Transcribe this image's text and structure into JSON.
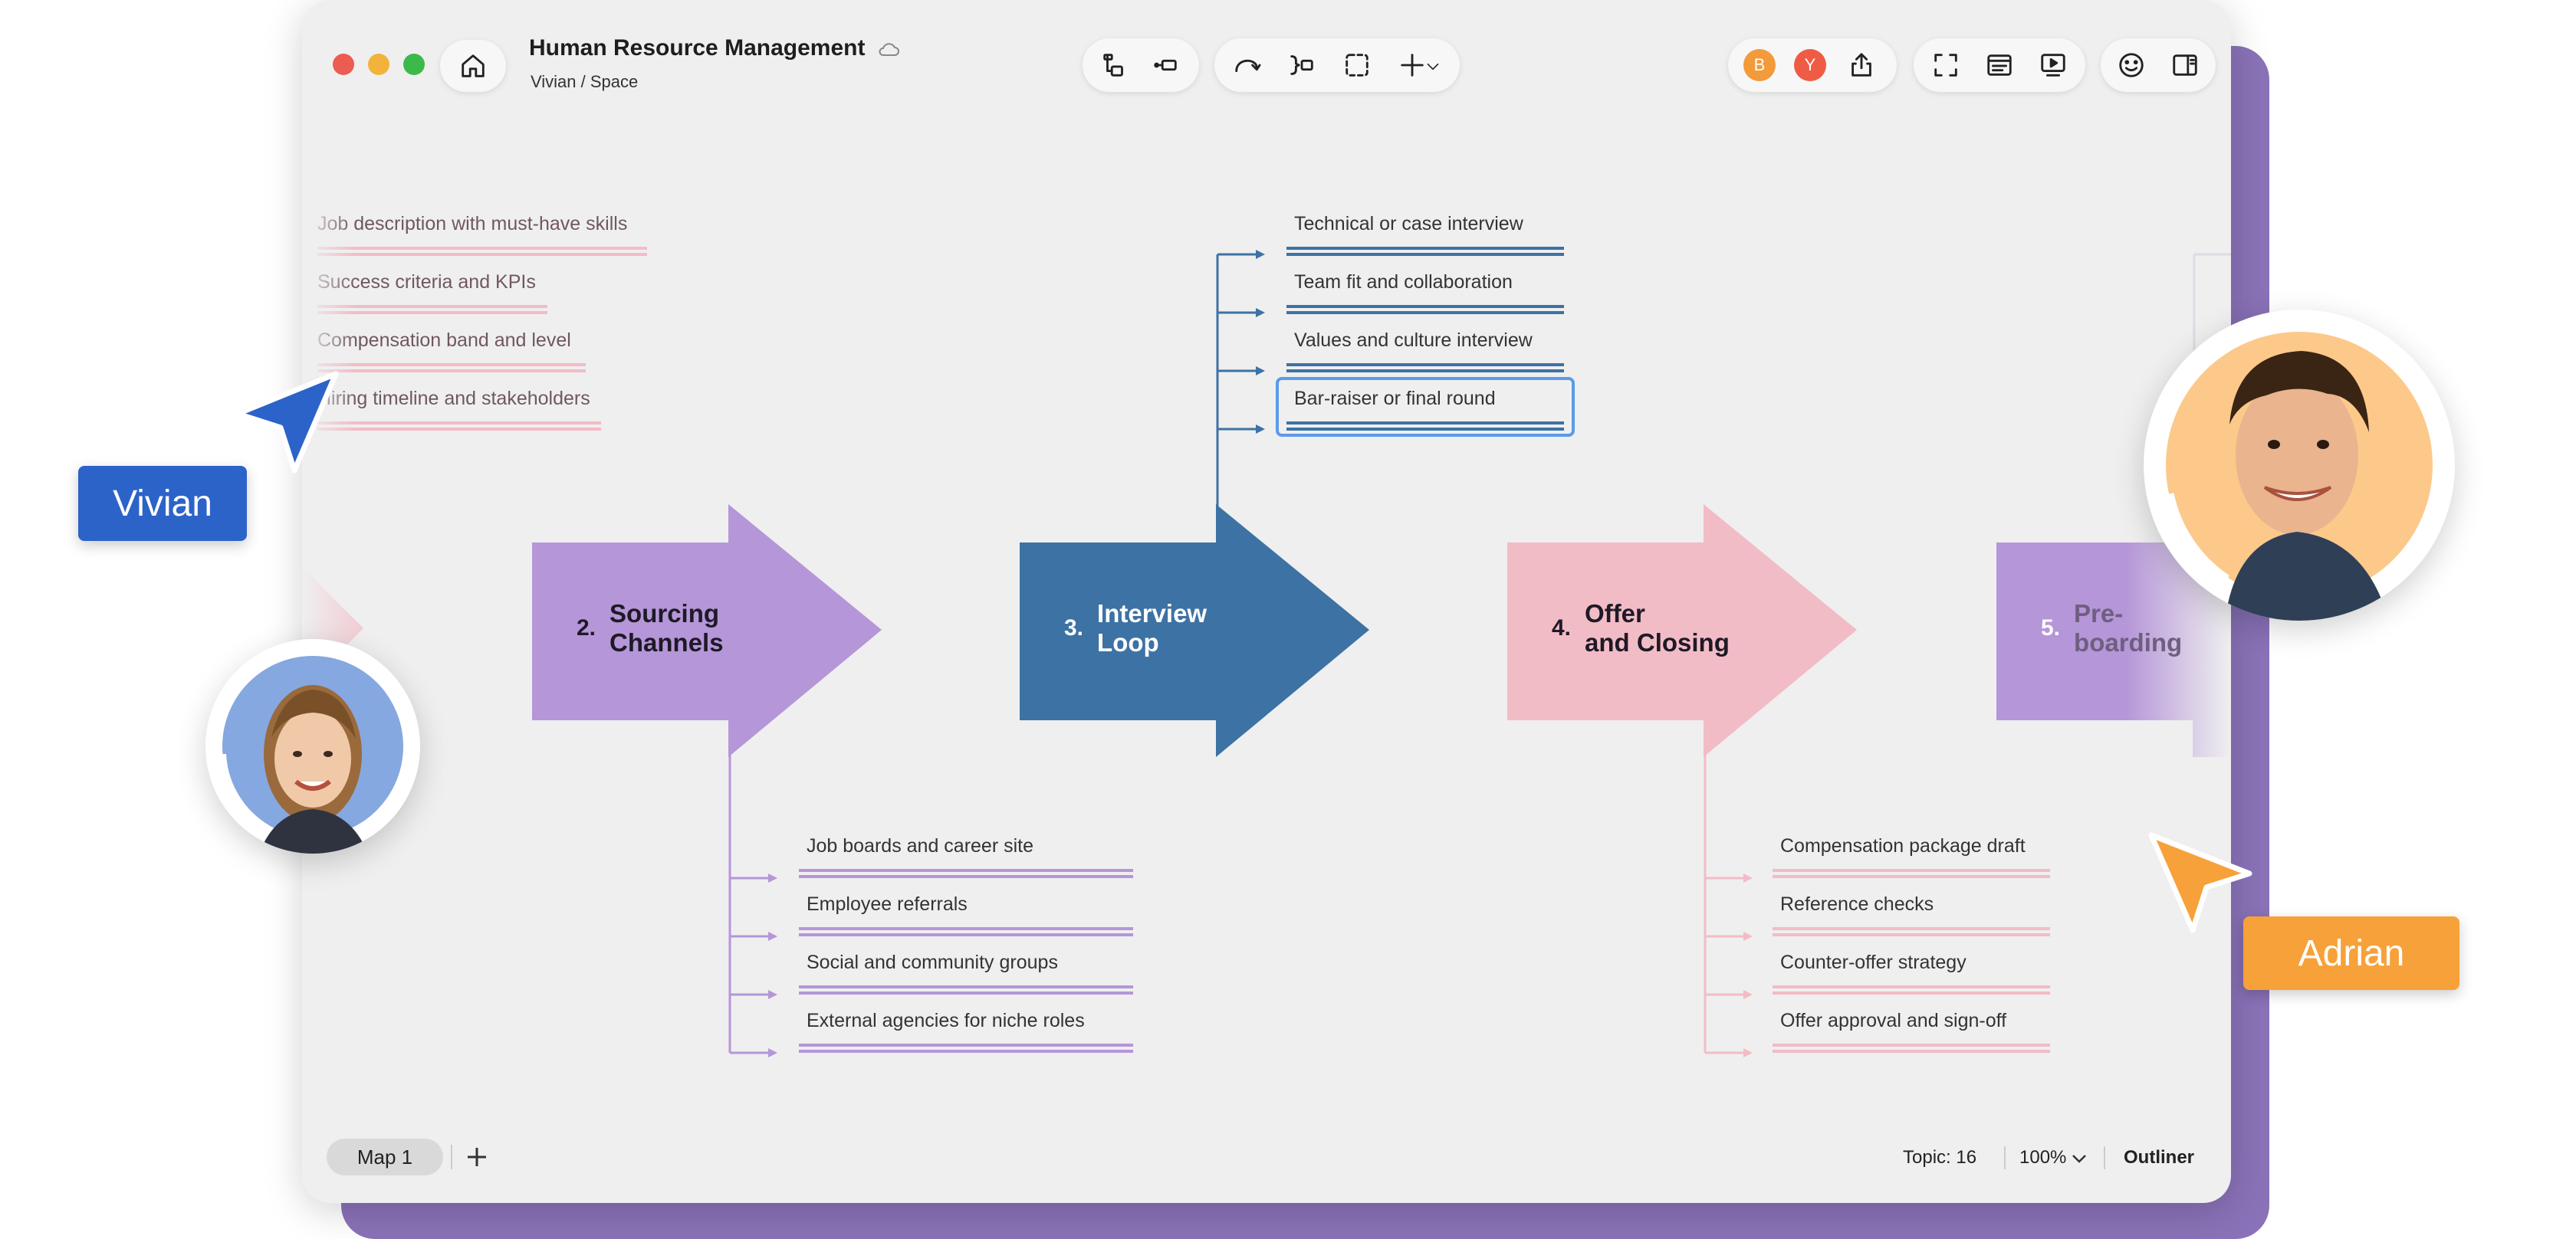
{
  "window": {
    "title": "Human Resource Management",
    "breadcrumb": "Vivian / Space"
  },
  "collaborators": [
    {
      "initial": "B",
      "color": "#f39a3a"
    },
    {
      "initial": "Y",
      "color": "#ef5b45"
    }
  ],
  "left_topics": [
    "Job description with must-have skills",
    "Success criteria and KPIs",
    "Compensation band and level",
    "Hiring timeline and stakeholders"
  ],
  "stages": [
    {
      "num": "2.",
      "line1": "Sourcing",
      "line2": "Channels",
      "color": "#b596d8"
    },
    {
      "num": "3.",
      "line1": "Interview",
      "line2": "Loop",
      "color": "#3d72a4"
    },
    {
      "num": "4.",
      "line1": "Offer",
      "line2": "and Closing",
      "color": "#f2bcc7"
    },
    {
      "num": "5.",
      "line1": "Pre-",
      "line2": "boarding",
      "color": "#b596d8"
    }
  ],
  "interview_topics": [
    "Technical or case interview",
    "Team fit and collaboration",
    "Values and culture interview",
    "Bar-raiser or final round"
  ],
  "sourcing_topics": [
    "Job boards and career site",
    "Employee referrals",
    "Social and community groups",
    "External agencies for niche roles"
  ],
  "offer_topics": [
    "Compensation package draft",
    "Reference checks",
    "Counter-offer strategy",
    "Offer approval and sign-off"
  ],
  "cursors": {
    "vivian": {
      "name": "Vivian",
      "color": "#2c63c9"
    },
    "adrian": {
      "name": "Adrian",
      "color": "#f7a13a"
    }
  },
  "bottom": {
    "map_tab": "Map 1",
    "topic_count": "Topic: 16",
    "zoom": "100%",
    "outliner": "Outliner"
  },
  "icons": [
    "home-icon",
    "cloud-icon",
    "subtopic-icon",
    "sibling-topic-icon",
    "relationship-icon",
    "summary-icon",
    "boundary-icon",
    "insert-icon",
    "share-icon",
    "fullscreen-icon",
    "outline-view-icon",
    "presentation-icon",
    "sticker-icon",
    "sidebar-toggle-icon",
    "add-sheet-icon",
    "chevron-down-icon"
  ]
}
